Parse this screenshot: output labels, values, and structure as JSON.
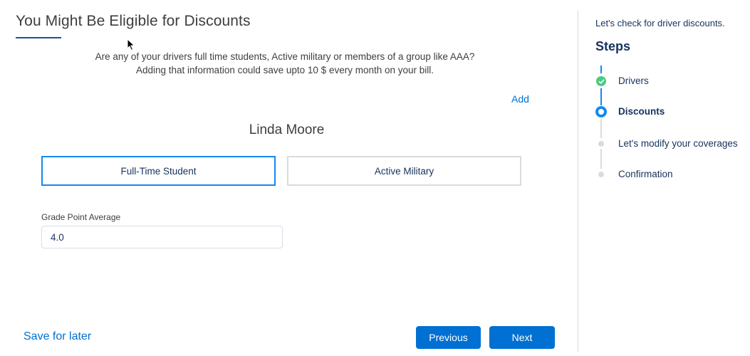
{
  "main": {
    "title": "You Might Be Eligible for Discounts",
    "intro_line1": "Are any of your drivers full time students, Active military or members of a group like AAA?",
    "intro_line2": "Adding that information could save upto 10 $ every month on your bill.",
    "add_label": "Add",
    "driver_name": "Linda Moore",
    "options": [
      {
        "label": "Full-Time Student",
        "selected": true
      },
      {
        "label": "Active Military",
        "selected": false
      }
    ],
    "gpa": {
      "label": "Grade Point Average",
      "value": "4.0"
    },
    "save_for_later": "Save for later",
    "previous_label": "Previous",
    "next_label": "Next"
  },
  "sidebar": {
    "description": "Let's check for driver discounts.",
    "steps_title": "Steps",
    "steps": [
      {
        "label": "Drivers",
        "status": "complete"
      },
      {
        "label": "Discounts",
        "status": "current"
      },
      {
        "label": "Let's modify your coverages",
        "status": "upcoming"
      },
      {
        "label": "Confirmation",
        "status": "upcoming"
      }
    ]
  },
  "colors": {
    "brand": "#0070d2",
    "active_step": "#1589ee",
    "complete_step": "#4bca81",
    "pending_step": "#dddbda",
    "title_accent": "#1b5297"
  },
  "icons": {
    "complete": "check-icon",
    "current": "ring-icon",
    "upcoming": "dot-icon"
  }
}
